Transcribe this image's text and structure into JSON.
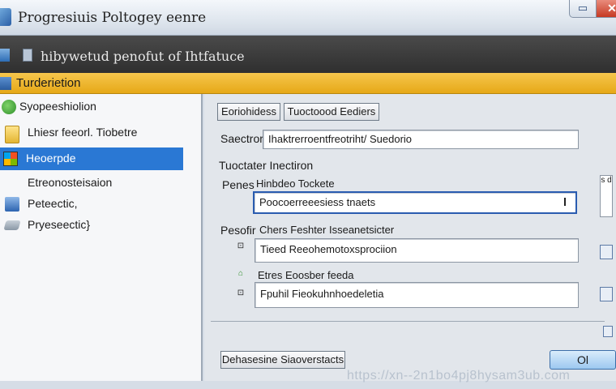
{
  "window": {
    "title": "Progresiuis Poltogey eenre",
    "restore_label": "▭",
    "close_label": "✕"
  },
  "header": {
    "text": "hibywetud penofut of Ihtfatuce"
  },
  "section": {
    "title": "Turderietion"
  },
  "sidebar": {
    "items": [
      {
        "label": "Syopeeshiolion",
        "icon": "leaf-icon"
      },
      {
        "label": "Lhiesr feeorl. Tiobetre",
        "icon": "folder-icon"
      },
      {
        "label": "Heoerpde",
        "icon": "windows-icon",
        "selected": true
      },
      {
        "label": "Etreonosteisaion",
        "icon": "none"
      },
      {
        "label": "Peteectic,",
        "icon": "computer-icon"
      },
      {
        "label": "Pryeseectic}",
        "icon": "drive-icon"
      }
    ]
  },
  "main": {
    "tab_button_1": "Eoriohidess",
    "tab_button_2": "Tuoctoood Eediers",
    "search_label": "Saectrory",
    "search_value": "Ihaktrerroentfreotriht/ Suedorio",
    "section_heading": "Tuoctater Inectiron",
    "parent_label": "Penes",
    "parent_sub": "Hinbdeo Tockete",
    "parent_value": "Poocoerreeesiess tnaets",
    "profile_label": "Pesofir",
    "profile_sub": "Chers Feshter Isseanetsicter",
    "row1_icon": "⊡",
    "row1_value": "Tieed Reeohemotoxsprociion",
    "row2_icon": "⊡",
    "row2_sub": "Etres Eoosber feeda",
    "row2_value": "Fpuhil Fieokuhnhoedeletia",
    "side_label": "s\nd",
    "bottom_button": "Dehasesine Siaoverstacts",
    "ok_button": "Ol"
  },
  "watermark": "https://xn--2n1bo4pj8hysam3ub.com"
}
